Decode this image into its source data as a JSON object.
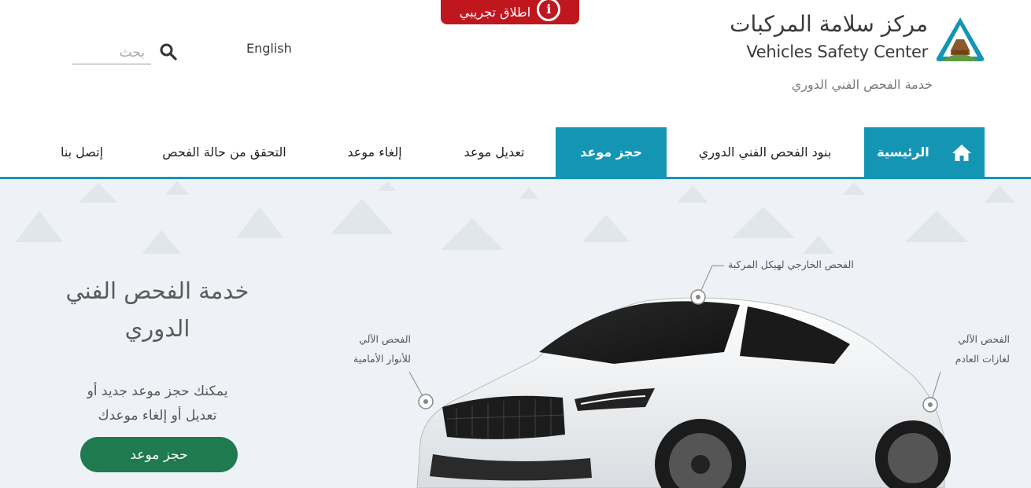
{
  "banner": {
    "label": "اطلاق تجريبي"
  },
  "logo": {
    "arabic": "مركز سلامة المركبات",
    "english": "Vehicles Safety Center",
    "subtitle": "خدمة الفحص الفني الدوري"
  },
  "header": {
    "language_link": "English",
    "search_placeholder": "بحث"
  },
  "nav": {
    "items": [
      {
        "label": "الرئيسية",
        "active": true
      },
      {
        "label": "بنود الفحص الفني الدوري",
        "active": false
      },
      {
        "label": "حجز موعد",
        "active": true
      },
      {
        "label": "تعديل موعد",
        "active": false
      },
      {
        "label": "إلغاء موعد",
        "active": false
      },
      {
        "label": "التحقق من حالة الفحص",
        "active": false
      },
      {
        "label": "إتصل بنا",
        "active": false
      }
    ]
  },
  "hero": {
    "title_line1": "خدمة الفحص الفني",
    "title_line2": "الدوري",
    "text_line1": "يمكنك حجز موعد جديد أو",
    "text_line2": "تعديل أو إلغاء موعدك",
    "cta_label": "حجز موعد"
  },
  "callouts": {
    "body": "الفحص الخارجي لهيكل المركبة",
    "headlights_line1": "الفحص الآلي",
    "headlights_line2": "للأنوار الأمامية",
    "exhaust_line1": "الفحص الآلي",
    "exhaust_line2": "لغازات العادم"
  },
  "colors": {
    "brand_teal": "#1595b4",
    "cta_green": "#1f7a4f",
    "banner_red": "#c0161d",
    "hero_bg": "#eef2f6"
  },
  "icons": [
    "info-icon",
    "search-icon",
    "home-icon",
    "logo-icon"
  ]
}
